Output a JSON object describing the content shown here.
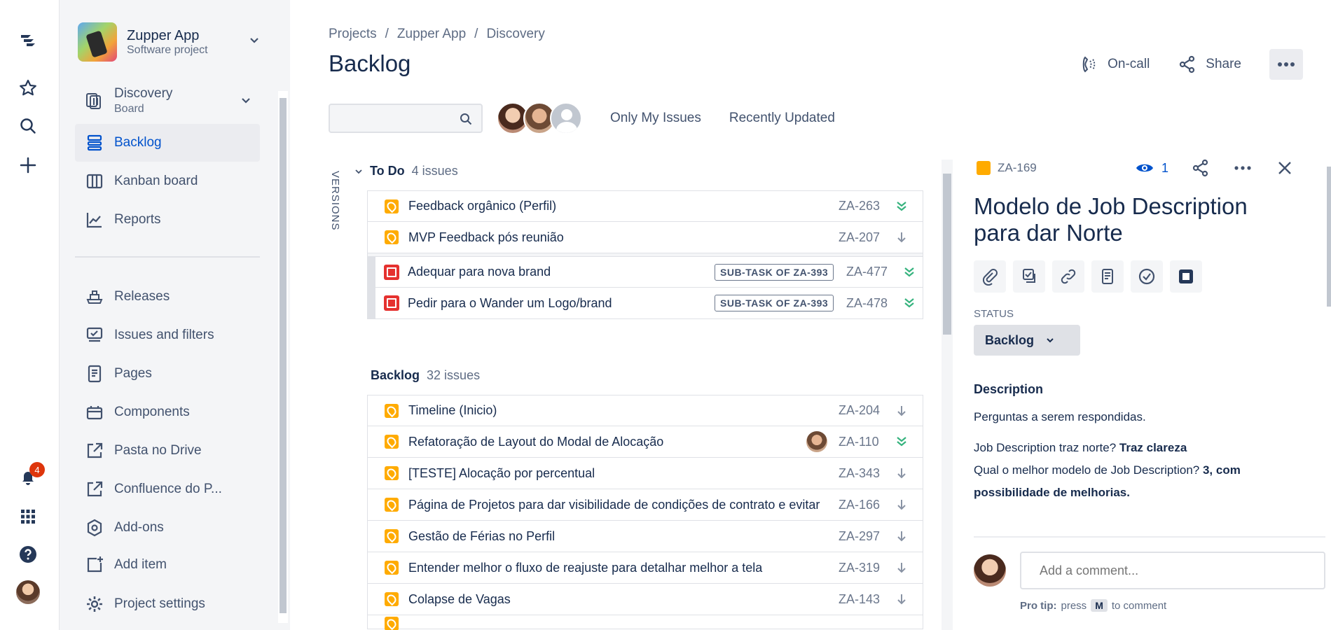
{
  "notifications": {
    "count": "4"
  },
  "sidebar": {
    "project_name": "Zupper App",
    "project_type": "Software project",
    "board": {
      "name": "Discovery",
      "sub": "Board"
    },
    "items": [
      {
        "label": "Backlog",
        "icon": "backlog-icon",
        "active": true
      },
      {
        "label": "Kanban board",
        "icon": "kanban-icon"
      },
      {
        "label": "Reports",
        "icon": "reports-icon"
      },
      {
        "label": "Releases",
        "icon": "releases-icon"
      },
      {
        "label": "Issues and filters",
        "icon": "issues-icon"
      },
      {
        "label": "Pages",
        "icon": "pages-icon"
      },
      {
        "label": "Components",
        "icon": "components-icon"
      },
      {
        "label": "Pasta no Drive",
        "icon": "external-link-icon"
      },
      {
        "label": "Confluence do P...",
        "icon": "external-link-icon"
      },
      {
        "label": "Add-ons",
        "icon": "addons-icon"
      },
      {
        "label": "Add item",
        "icon": "add-item-icon"
      },
      {
        "label": "Project settings",
        "icon": "gear-icon"
      }
    ]
  },
  "header": {
    "breadcrumbs": [
      "Projects",
      "/",
      "Zupper App",
      "/",
      "Discovery"
    ],
    "title": "Backlog",
    "oncall_label": "On-call",
    "share_label": "Share"
  },
  "filters": {
    "search_placeholder": "",
    "only_my_issues": "Only My Issues",
    "recently_updated": "Recently Updated"
  },
  "versions_label": "VERSIONS",
  "todo": {
    "name": "To Do",
    "count": "4 issues",
    "issues": [
      {
        "summary": "Feedback orgânico (Perfil)",
        "key": "ZA-263",
        "priority": "low",
        "sub": false
      },
      {
        "summary": "MVP Feedback pós reunião",
        "key": "ZA-207",
        "priority": "arrow",
        "sub": false
      },
      {
        "summary": "Adequar para nova brand",
        "key": "ZA-477",
        "priority": "low",
        "sub": true,
        "tag": "SUB-TASK OF ZA-393"
      },
      {
        "summary": "Pedir para o Wander um Logo/brand",
        "key": "ZA-478",
        "priority": "low",
        "sub": true,
        "tag": "SUB-TASK OF ZA-393"
      }
    ]
  },
  "backlog": {
    "name": "Backlog",
    "count": "32 issues",
    "issues": [
      {
        "summary": "Timeline (Inicio)",
        "key": "ZA-204",
        "priority": "arrow"
      },
      {
        "summary": "Refatoração de Layout do Modal de Alocação",
        "key": "ZA-110",
        "priority": "low",
        "assignee": true
      },
      {
        "summary": "[TESTE] Alocação por percentual",
        "key": "ZA-343",
        "priority": "arrow"
      },
      {
        "summary": "Página de Projetos para dar visibilidade de condições de contrato e evitar",
        "key": "ZA-166",
        "priority": "arrow"
      },
      {
        "summary": "Gestão de Férias no Perfil",
        "key": "ZA-297",
        "priority": "arrow"
      },
      {
        "summary": "Entender melhor o fluxo de reajuste para detalhar melhor a tela",
        "key": "ZA-319",
        "priority": "arrow"
      },
      {
        "summary": "Colapse de Vagas",
        "key": "ZA-143",
        "priority": "arrow"
      }
    ]
  },
  "detail": {
    "key": "ZA-169",
    "watchers": "1",
    "title": "Modelo de Job Description para dar Norte",
    "status_label": "STATUS",
    "status": "Backlog",
    "description_label": "Description",
    "desc_line1": "Perguntas a serem respondidas.",
    "q1": "Job Description traz norte?",
    "a1": "Traz clareza",
    "q2": "Qual o melhor modelo de Job Description?",
    "a2": "3, com possibilidade de melhorias.",
    "comment_placeholder": "Add a comment...",
    "tip_prefix": "Pro tip:",
    "tip_press": "press",
    "tip_key": "M",
    "tip_suffix": "to comment"
  },
  "colors": {
    "accent": "#0052cc",
    "story": "#ffab00",
    "subtask": "#e5312f",
    "priority_low": "#36b37e"
  }
}
